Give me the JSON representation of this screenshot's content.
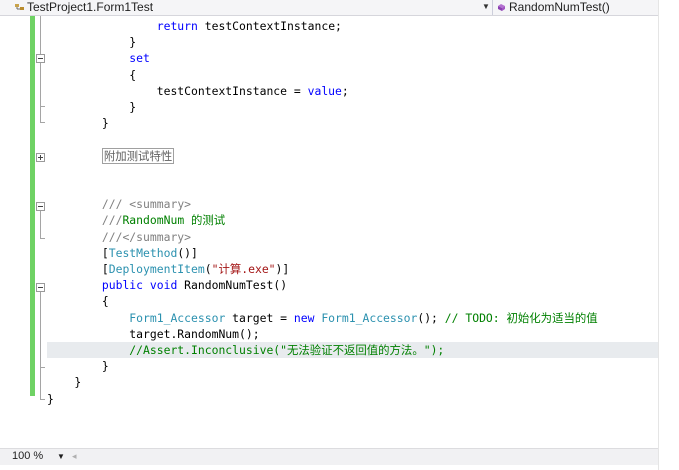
{
  "navbar": {
    "class_label": "TestProject1.Form1Test",
    "member_label": "RandomNumTest()",
    "class_icon": "class-icon",
    "member_icon": "method-icon",
    "dropdown_glyph": "▼"
  },
  "code_lines": [
    {
      "tokens": [
        {
          "t": "                "
        },
        {
          "t": "return",
          "c": "kw"
        },
        {
          "t": " testContextInstance;"
        }
      ]
    },
    {
      "tokens": [
        {
          "t": "            }"
        }
      ]
    },
    {
      "tokens": [
        {
          "t": "            "
        },
        {
          "t": "set",
          "c": "kw"
        }
      ]
    },
    {
      "tokens": [
        {
          "t": "            {"
        }
      ]
    },
    {
      "tokens": [
        {
          "t": "                testContextInstance = "
        },
        {
          "t": "value",
          "c": "kw"
        },
        {
          "t": ";"
        }
      ]
    },
    {
      "tokens": [
        {
          "t": "            }"
        }
      ]
    },
    {
      "tokens": [
        {
          "t": "        }"
        }
      ]
    },
    {
      "tokens": []
    },
    {
      "tokens": [
        {
          "t": "        "
        },
        {
          "t": "附加测试特性",
          "c": "box"
        }
      ]
    },
    {
      "tokens": []
    },
    {
      "tokens": []
    },
    {
      "tokens": [
        {
          "t": "        ",
          "c": ""
        },
        {
          "t": "///",
          "c": "cmg"
        },
        {
          "t": " <summary>",
          "c": "cmg"
        }
      ]
    },
    {
      "tokens": [
        {
          "t": "        "
        },
        {
          "t": "///",
          "c": "cmg"
        },
        {
          "t": "RandomNum 的测试",
          "c": "cm"
        }
      ]
    },
    {
      "tokens": [
        {
          "t": "        "
        },
        {
          "t": "///</summary>",
          "c": "cmg"
        }
      ]
    },
    {
      "tokens": [
        {
          "t": "        ["
        },
        {
          "t": "TestMethod",
          "c": "ty"
        },
        {
          "t": "()]"
        }
      ]
    },
    {
      "tokens": [
        {
          "t": "        ["
        },
        {
          "t": "DeploymentItem",
          "c": "ty"
        },
        {
          "t": "("
        },
        {
          "t": "\"计算.exe\"",
          "c": "st"
        },
        {
          "t": ")]"
        }
      ]
    },
    {
      "tokens": [
        {
          "t": "        "
        },
        {
          "t": "public",
          "c": "kw"
        },
        {
          "t": " "
        },
        {
          "t": "void",
          "c": "kw"
        },
        {
          "t": " RandomNumTest()"
        }
      ]
    },
    {
      "tokens": [
        {
          "t": "        {"
        }
      ]
    },
    {
      "tokens": [
        {
          "t": "            "
        },
        {
          "t": "Form1_Accessor",
          "c": "ty"
        },
        {
          "t": " target = "
        },
        {
          "t": "new",
          "c": "kw"
        },
        {
          "t": " "
        },
        {
          "t": "Form1_Accessor",
          "c": "ty"
        },
        {
          "t": "(); "
        },
        {
          "t": "// TODO: 初始化为适当的值",
          "c": "cm"
        }
      ]
    },
    {
      "tokens": [
        {
          "t": "            target.RandomNum();"
        }
      ]
    },
    {
      "tokens": [
        {
          "t": "            "
        },
        {
          "t": "//Assert.Inconclusive(\"无法验证不返回值的方法。\");",
          "c": "cm"
        }
      ],
      "highlight": true
    },
    {
      "tokens": [
        {
          "t": "        }"
        }
      ]
    },
    {
      "tokens": [
        {
          "t": "    }"
        }
      ]
    },
    {
      "tokens": [
        {
          "t": "}"
        }
      ]
    }
  ],
  "statusbar": {
    "zoom_value": "100 %",
    "zoom_dropdown_glyph": "▼",
    "scroll_left_glyph": "◂"
  },
  "colors": {
    "keyword": "#0000ff",
    "type": "#2b91af",
    "comment": "#008000",
    "string": "#a31515",
    "changebar": "#6fd264"
  }
}
